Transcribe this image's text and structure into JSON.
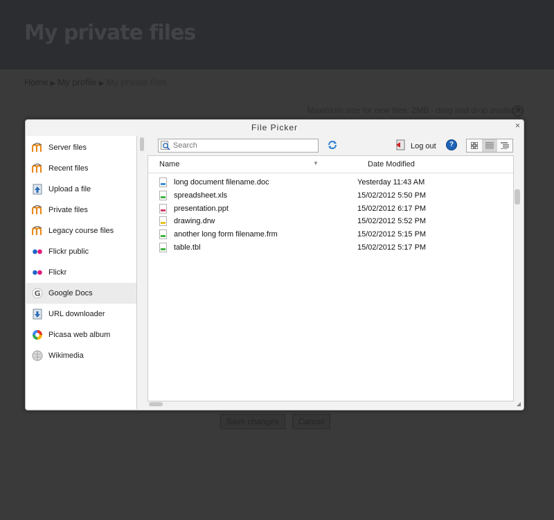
{
  "page": {
    "title": "My private files",
    "breadcrumb": [
      "Home",
      "My profile",
      "My private files"
    ],
    "max_size_text": "Maximum size for new files: 2MB - drag and drop available",
    "help_glyph": "?",
    "buttons": {
      "save": "Save changes",
      "cancel": "Cancel"
    }
  },
  "dialog": {
    "title": "File Picker",
    "close_glyph": "×",
    "repositories": [
      {
        "label": "Server files",
        "icon": "moodle-icon",
        "selected": false
      },
      {
        "label": "Recent files",
        "icon": "moodle-icon",
        "selected": false
      },
      {
        "label": "Upload a file",
        "icon": "upload-icon",
        "selected": false
      },
      {
        "label": "Private files",
        "icon": "moodle-icon",
        "selected": false
      },
      {
        "label": "Legacy course files",
        "icon": "moodle-icon",
        "selected": false
      },
      {
        "label": "Flickr public",
        "icon": "flickr-icon",
        "selected": false
      },
      {
        "label": "Flickr",
        "icon": "flickr-icon",
        "selected": false
      },
      {
        "label": "Google Docs",
        "icon": "google-icon",
        "selected": true
      },
      {
        "label": "URL downloader",
        "icon": "url-icon",
        "selected": false
      },
      {
        "label": "Picasa web album",
        "icon": "picasa-icon",
        "selected": false
      },
      {
        "label": "Wikimedia",
        "icon": "wikimedia-icon",
        "selected": false
      }
    ],
    "toolbar": {
      "search_placeholder": "Search",
      "logout_label": "Log out",
      "help_glyph": "?"
    },
    "list": {
      "columns": {
        "name": "Name",
        "date": "Date Modified"
      },
      "files": [
        {
          "name": "long document filename.doc",
          "date": "Yesterday 11:43 AM",
          "color": "#3c8fd6"
        },
        {
          "name": "spreadsheet.xls",
          "date": "15/02/2012 5:50 PM",
          "color": "#3fb43f"
        },
        {
          "name": "presentation.ppt",
          "date": "15/02/2012 6:17 PM",
          "color": "#d63c6a"
        },
        {
          "name": "drawing.drw",
          "date": "15/02/2012 5:52 PM",
          "color": "#e8c21c"
        },
        {
          "name": "another long form filename.frm",
          "date": "15/02/2012 5:15 PM",
          "color": "#3fb43f"
        },
        {
          "name": "table.tbl",
          "date": "15/02/2012 5:17 PM",
          "color": "#3fb43f"
        }
      ]
    }
  }
}
